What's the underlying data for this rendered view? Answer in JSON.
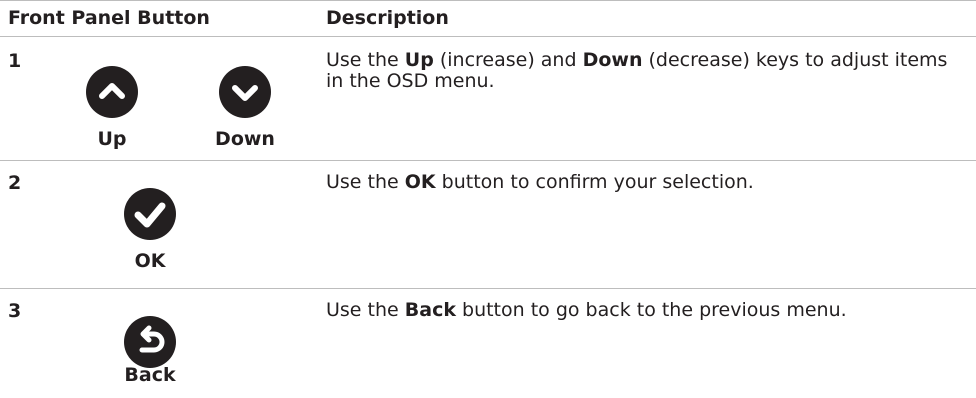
{
  "table": {
    "headers": {
      "button": "Front Panel Button",
      "description": "Description"
    },
    "rows": [
      {
        "number": "1",
        "buttons": [
          {
            "label": "Up",
            "icon": "chevron-up-icon"
          },
          {
            "label": "Down",
            "icon": "chevron-down-icon"
          }
        ],
        "description": {
          "p1": "Use the ",
          "b1": "Up",
          "p2": " (increase) and ",
          "b2": "Down",
          "p3": " (decrease) keys to adjust items in the OSD menu."
        }
      },
      {
        "number": "2",
        "buttons": [
          {
            "label": "OK",
            "icon": "checkmark-icon"
          }
        ],
        "description": {
          "p1": "Use the ",
          "b1": "OK",
          "p2": " button to confirm your selection."
        }
      },
      {
        "number": "3",
        "buttons": [
          {
            "label": "Back",
            "icon": "back-arrow-icon"
          }
        ],
        "description": {
          "p1": "Use the ",
          "b1": "Back",
          "p2": " button to go back to the previous menu."
        }
      }
    ]
  },
  "colors": {
    "text": "#231f20",
    "icon_fill": "#231f20",
    "rule": "#bdbdbd"
  }
}
